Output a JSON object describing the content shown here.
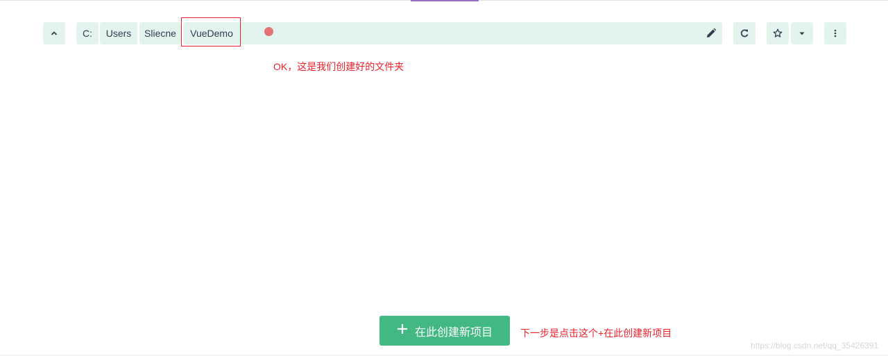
{
  "toolbar": {
    "up_icon": "chevron-up-icon",
    "breadcrumbs": [
      "C:",
      "Users",
      "Sliecne",
      "VueDemo"
    ],
    "edit_icon": "pencil-icon",
    "refresh_icon": "refresh-icon",
    "favorite_icon": "star-icon",
    "dropdown_icon": "caret-down-icon",
    "more_icon": "more-vertical-icon"
  },
  "annotations": {
    "folder_note": "OK，这是我们创建好的文件夹",
    "next_step_note": "下一步是点击这个+在此创建新项目"
  },
  "create_project": {
    "label": "在此创建新项目",
    "icon": "plus-icon"
  },
  "watermark": "https://blog.csdn.net/qq_35426391",
  "colors": {
    "pill_bg": "#e3f4ee",
    "accent_green": "#42b983",
    "annotation_red": "#e8222c",
    "text_dark": "#2c3e50"
  }
}
